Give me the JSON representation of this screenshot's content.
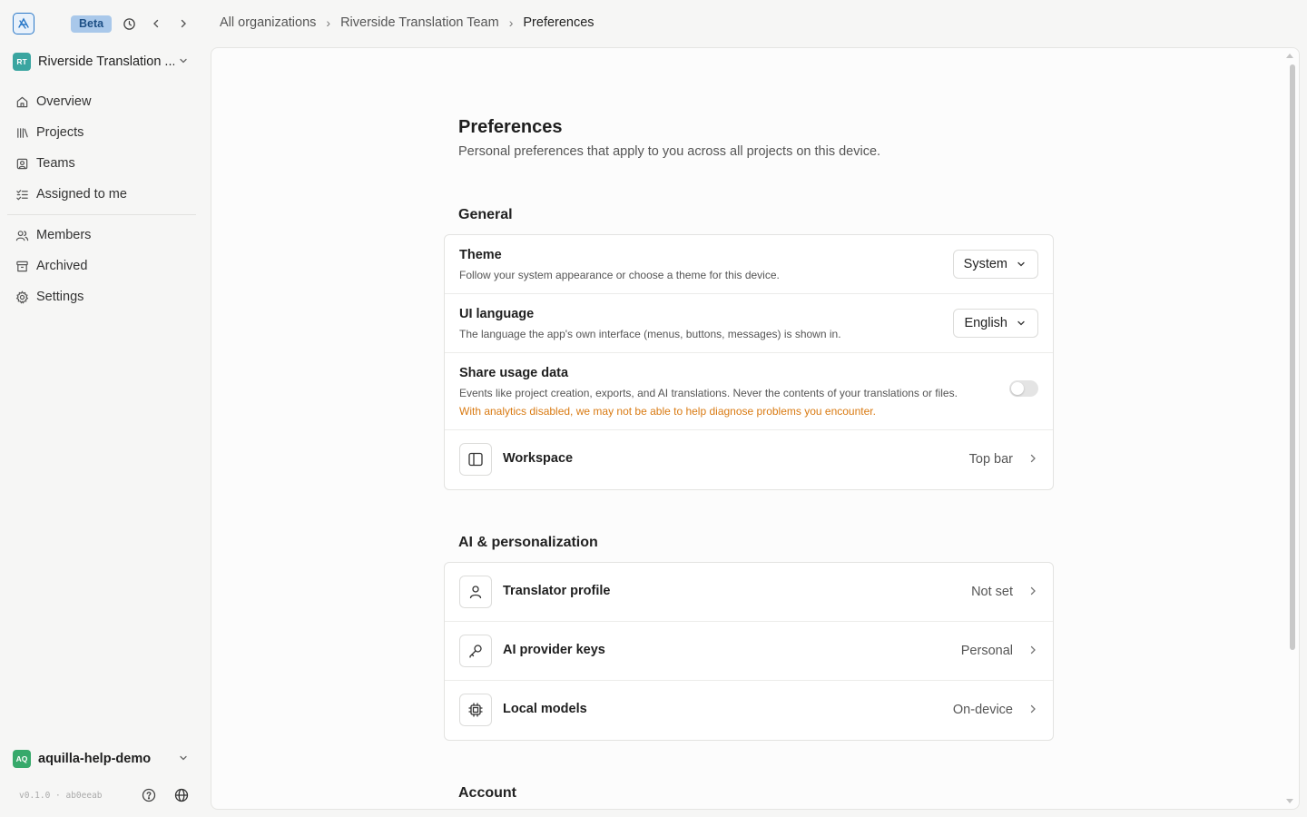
{
  "topbar": {
    "beta_label": "Beta",
    "breadcrumb": [
      "All organizations",
      "Riverside Translation Team",
      "Preferences"
    ]
  },
  "sidebar": {
    "org": {
      "initials": "RT",
      "name": "Riverside Translation ..."
    },
    "items": [
      {
        "label": "Overview",
        "icon": "home-icon"
      },
      {
        "label": "Projects",
        "icon": "library-icon"
      },
      {
        "label": "Teams",
        "icon": "contact-icon"
      },
      {
        "label": "Assigned to me",
        "icon": "list-check-icon"
      },
      {
        "label": "Members",
        "icon": "users-icon"
      },
      {
        "label": "Archived",
        "icon": "archive-icon"
      },
      {
        "label": "Settings",
        "icon": "gear-icon"
      }
    ],
    "user": {
      "initials": "AQ",
      "name": "aquilla-help-demo"
    },
    "version": "v0.1.0 · ab0eeab"
  },
  "page": {
    "title": "Preferences",
    "subtitle": "Personal preferences that apply to you across all projects on this device."
  },
  "general": {
    "title": "General",
    "theme": {
      "title": "Theme",
      "desc": "Follow your system appearance or choose a theme for this device.",
      "value": "System"
    },
    "ui_language": {
      "title": "UI language",
      "desc": "The language the app's own interface (menus, buttons, messages) is shown in.",
      "value": "English"
    },
    "usage": {
      "title": "Share usage data",
      "desc": "Events like project creation, exports, and AI translations. Never the contents of your translations or files.",
      "warning": "With analytics disabled, we may not be able to help diagnose problems you encounter.",
      "enabled": false
    },
    "workspace": {
      "label": "Workspace",
      "value": "Top bar"
    }
  },
  "ai": {
    "title": "AI & personalization",
    "rows": [
      {
        "label": "Translator profile",
        "value": "Not set",
        "icon": "user-icon"
      },
      {
        "label": "AI provider keys",
        "value": "Personal",
        "icon": "key-icon"
      },
      {
        "label": "Local models",
        "value": "On-device",
        "icon": "chip-icon"
      }
    ]
  },
  "account": {
    "title": "Account"
  }
}
